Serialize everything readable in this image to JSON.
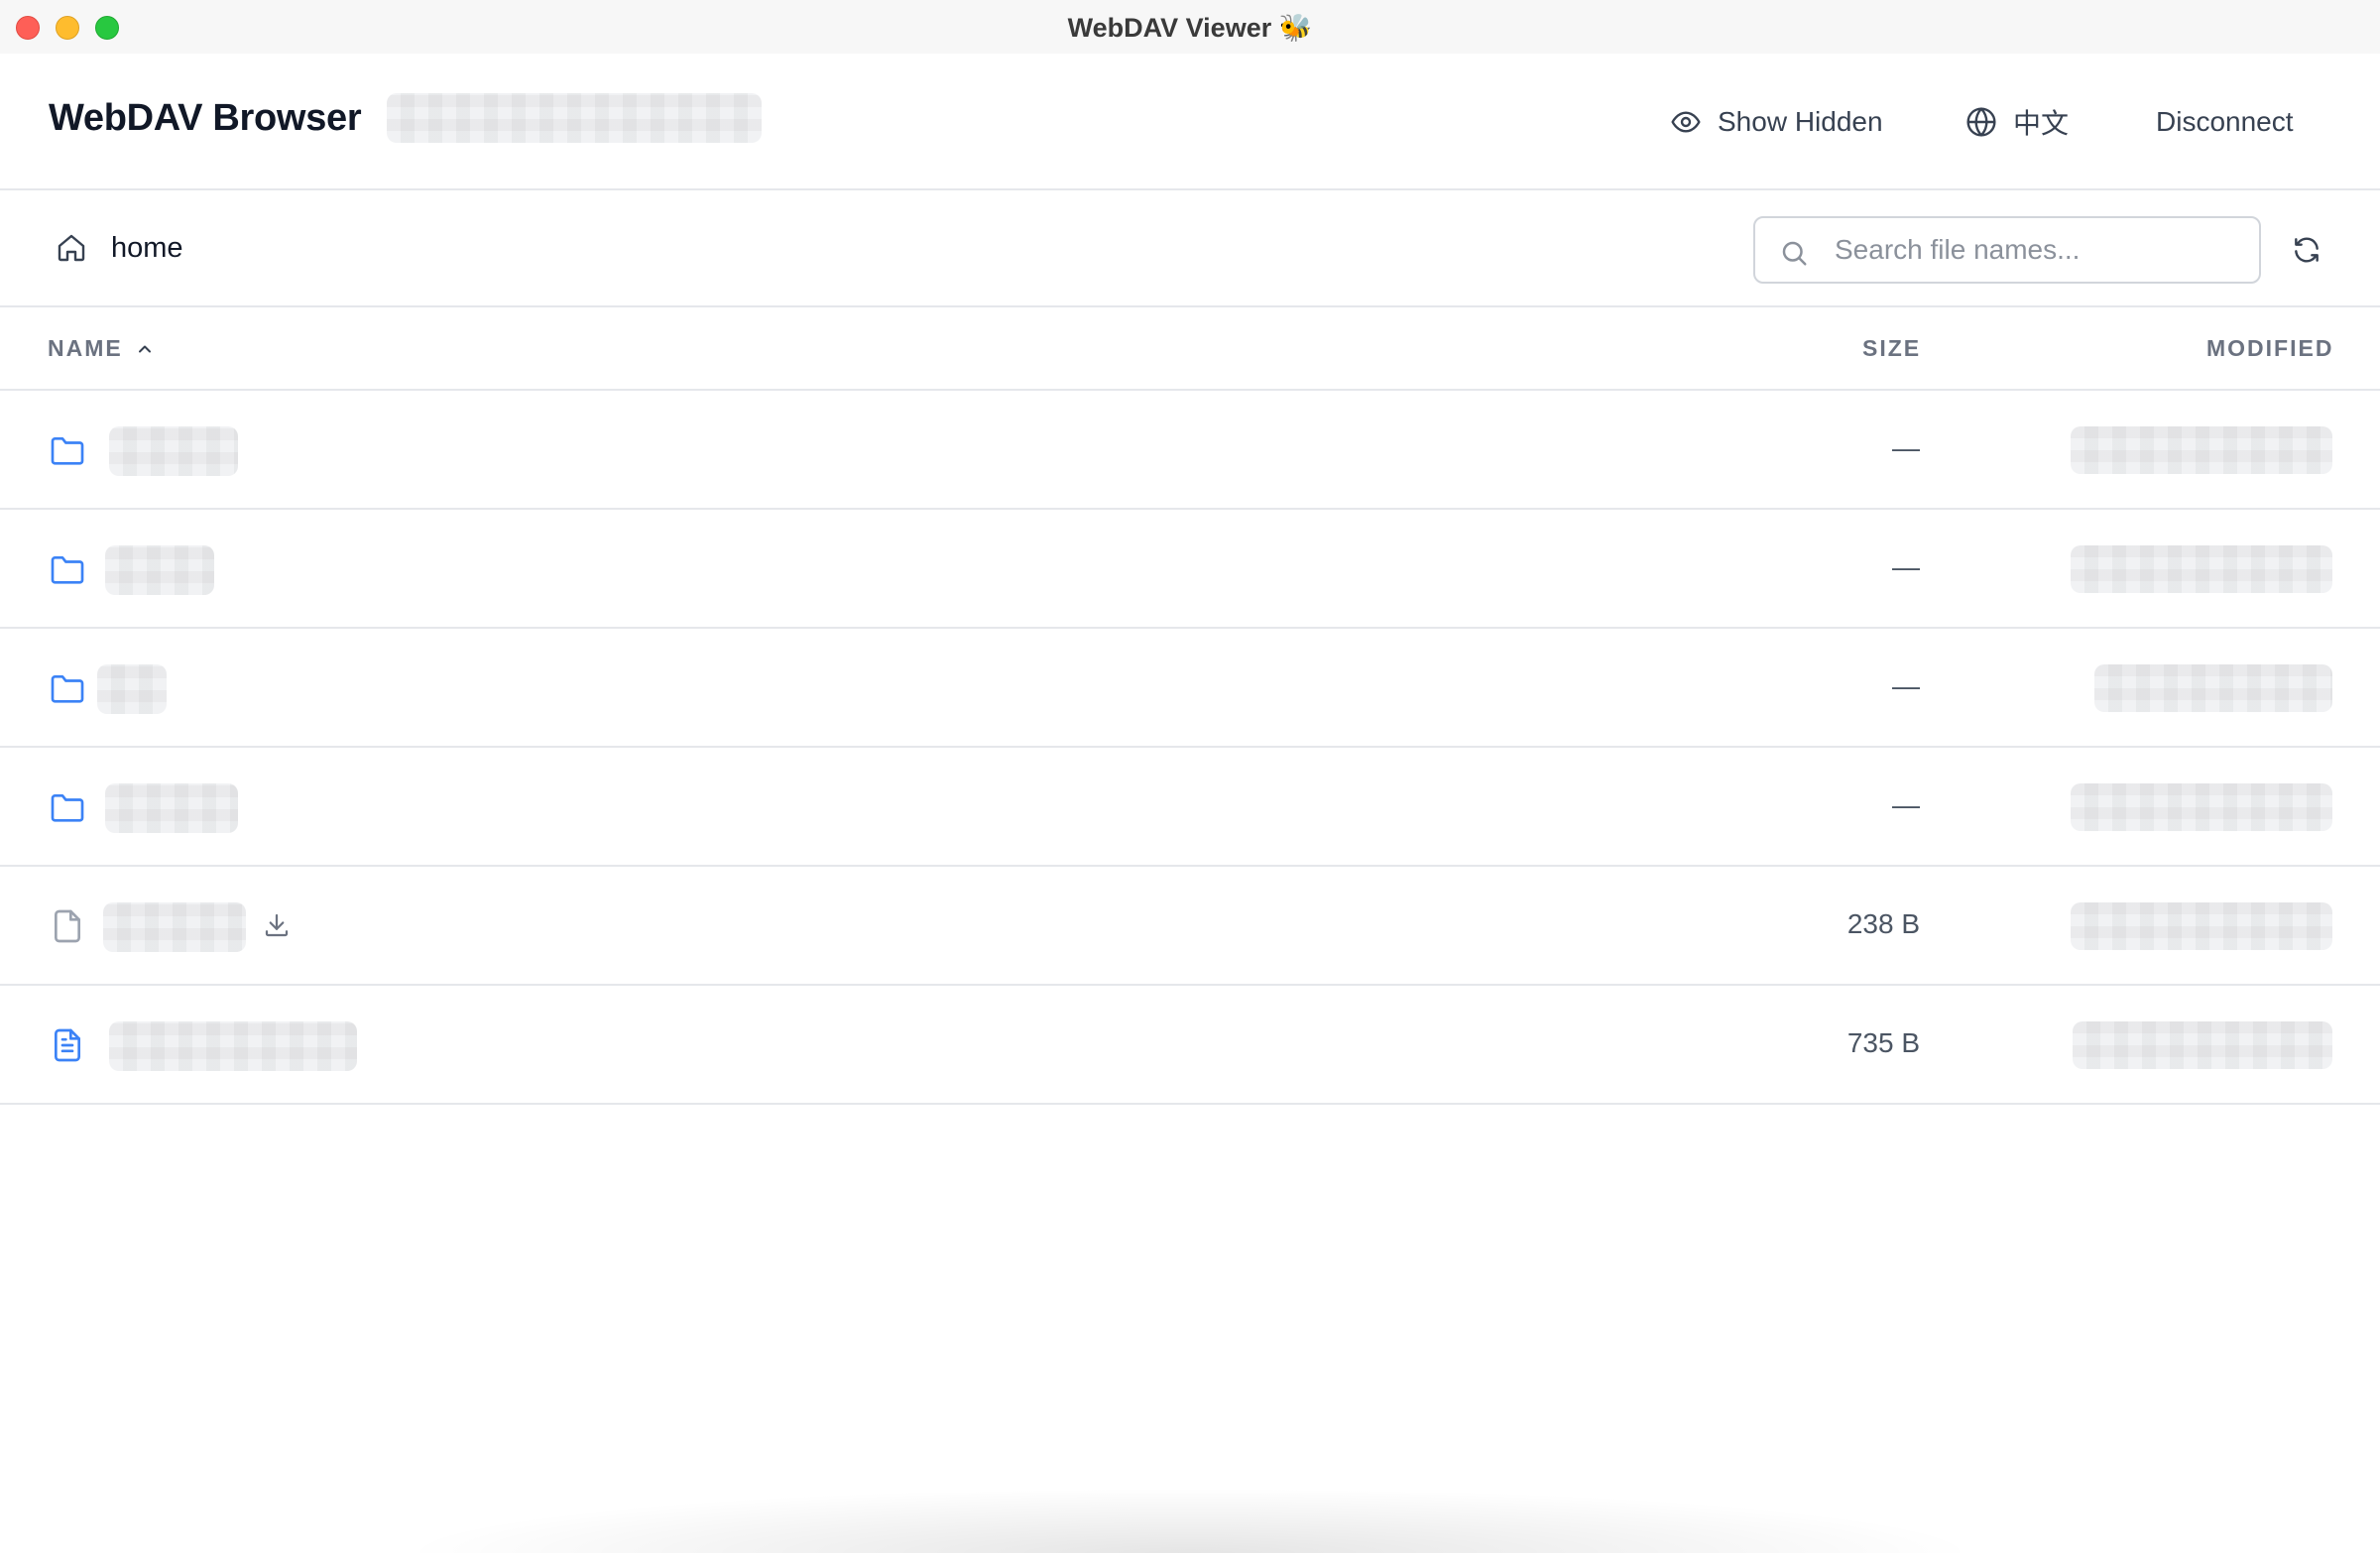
{
  "window": {
    "title": "WebDAV Viewer 🐝"
  },
  "header": {
    "brand": "WebDAV Browser",
    "show_hidden_label": "Show Hidden",
    "language_label": "中文",
    "disconnect_label": "Disconnect"
  },
  "toolbar": {
    "breadcrumb": "home",
    "search_placeholder": "Search file names...",
    "search_value": ""
  },
  "table": {
    "columns": {
      "name": "NAME",
      "size": "SIZE",
      "modified": "MODIFIED"
    },
    "sort": {
      "column": "name",
      "direction": "ascending"
    },
    "rows": [
      {
        "type": "folder",
        "size": "—"
      },
      {
        "type": "folder",
        "size": "—"
      },
      {
        "type": "folder",
        "size": "—"
      },
      {
        "type": "folder",
        "size": "—"
      },
      {
        "type": "file",
        "size": "238 B",
        "downloadable": true
      },
      {
        "type": "text-file",
        "size": "735 B"
      }
    ]
  },
  "colors": {
    "accent": "#3b82f6",
    "border": "#e5e7eb",
    "muted_text": "#6b7280",
    "close": "#fe5f57",
    "minimize": "#febc2e",
    "maximize": "#28c840"
  },
  "icons": {
    "show_hidden": "eye-icon",
    "language": "globe-icon",
    "home": "home-icon",
    "search": "search-icon",
    "refresh": "refresh-icon",
    "sort": "chevron-up-icon",
    "folder": "folder-icon",
    "file": "file-icon",
    "text_file": "file-text-icon",
    "download": "download-icon"
  }
}
